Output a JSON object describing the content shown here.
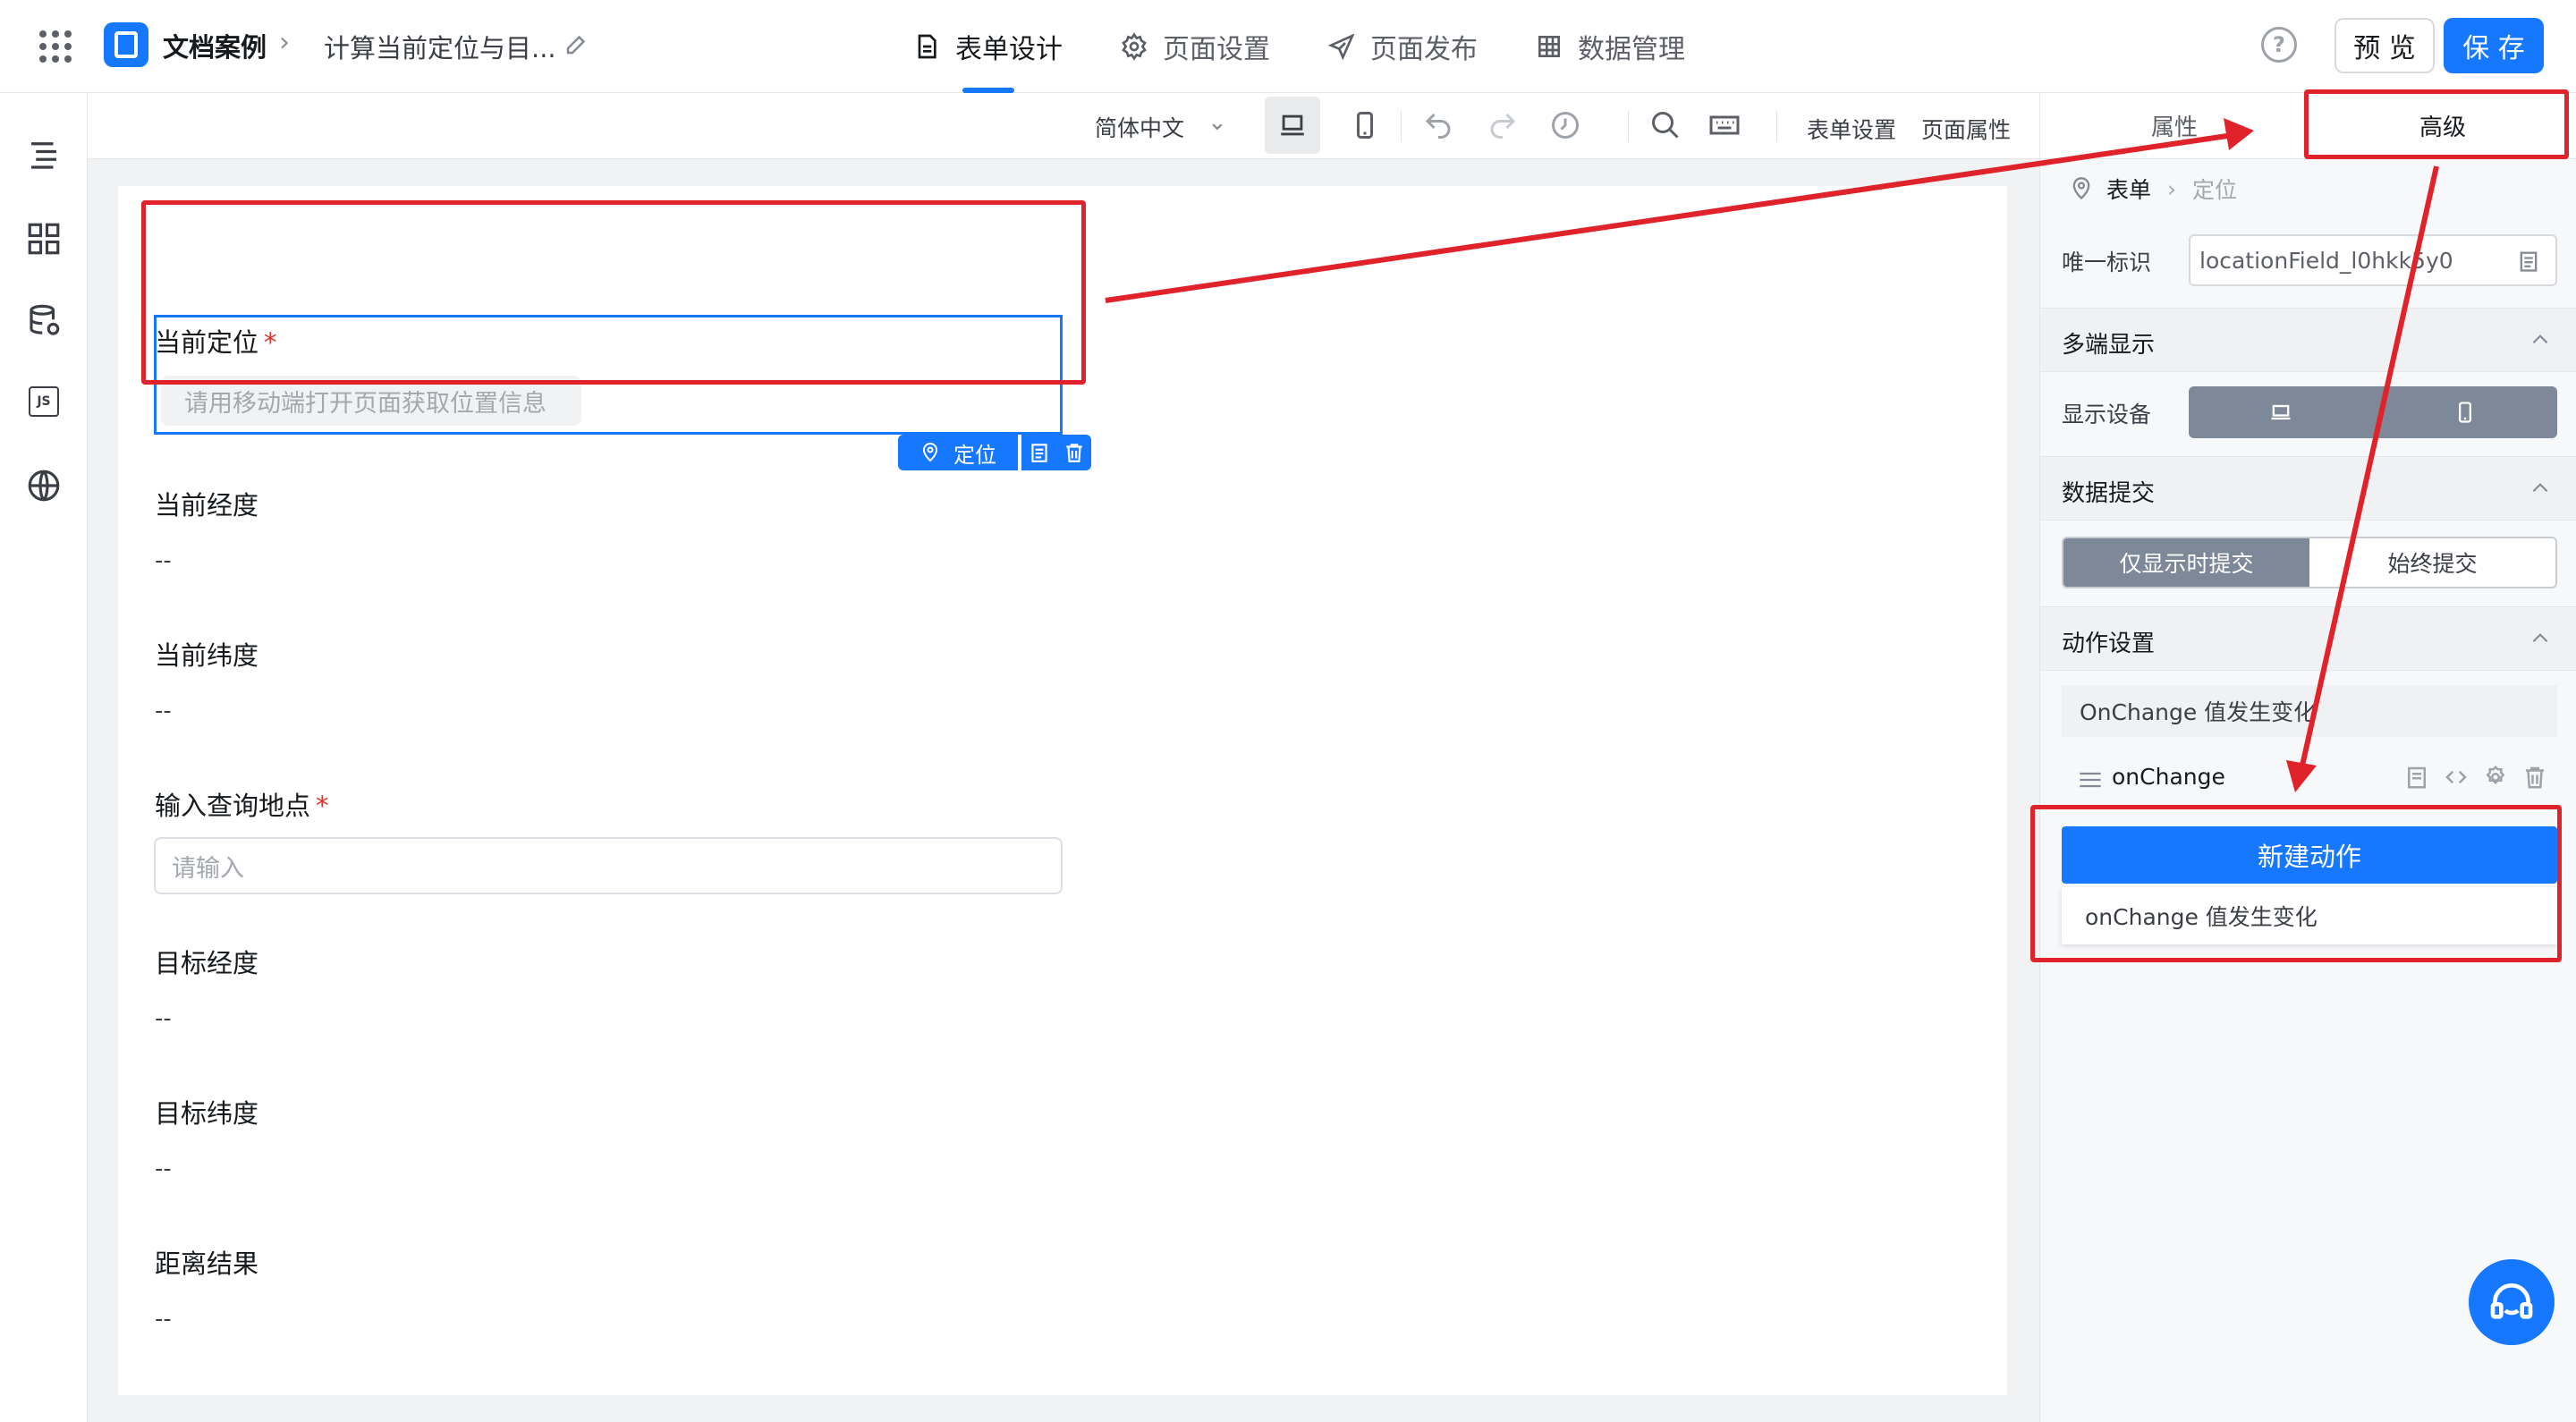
{
  "header": {
    "app_name": "文档案例",
    "page_name": "计算当前定位与目...",
    "tabs": [
      {
        "label": "表单设计",
        "icon": "document-icon",
        "active": true
      },
      {
        "label": "页面设置",
        "icon": "gear-icon",
        "active": false
      },
      {
        "label": "页面发布",
        "icon": "paper-plane-icon",
        "active": false
      },
      {
        "label": "数据管理",
        "icon": "table-icon",
        "active": false
      }
    ],
    "help_label": "?",
    "preview_label": "预 览",
    "save_label": "保 存"
  },
  "rail": {
    "items": [
      "outline-icon",
      "components-icon",
      "datasource-icon",
      "js-icon",
      "globe-icon"
    ],
    "js_label": "JS"
  },
  "toolbar": {
    "language": "简体中文",
    "form_settings": "表单设置",
    "page_props": "页面属性"
  },
  "form": {
    "fields": [
      {
        "label": "当前定位",
        "required": true,
        "placeholder": "请用移动端打开页面获取位置信息",
        "tag": "定位"
      },
      {
        "label": "当前经度",
        "value": "--"
      },
      {
        "label": "当前纬度",
        "value": "--"
      },
      {
        "label": "输入查询地点",
        "required": true,
        "placeholder": "请输入"
      },
      {
        "label": "目标经度",
        "value": "--"
      },
      {
        "label": "目标纬度",
        "value": "--"
      },
      {
        "label": "距离结果",
        "value": "--"
      }
    ],
    "required_mark": "*"
  },
  "panel": {
    "tabs": [
      {
        "label": "属性",
        "active": false
      },
      {
        "label": "高级",
        "active": true
      }
    ],
    "breadcrumb": [
      "表单",
      "定位"
    ],
    "unique_id_label": "唯一标识",
    "unique_id_value": "locationField_l0hkk5y0",
    "sections": {
      "multi_display": "多端显示",
      "data_submit": "数据提交",
      "action_settings": "动作设置"
    },
    "display_device_label": "显示设备",
    "submit_options": [
      "仅显示时提交",
      "始终提交"
    ],
    "submit_selected": "仅显示时提交",
    "action_head": "OnChange 值发生变化",
    "action_name": "onChange",
    "new_action_label": "新建动作",
    "dropdown_option": "onChange 值发生变化"
  },
  "colors": {
    "brand": "#1677ff",
    "annotation": "#e0222a",
    "segment_active": "#7d8898"
  }
}
